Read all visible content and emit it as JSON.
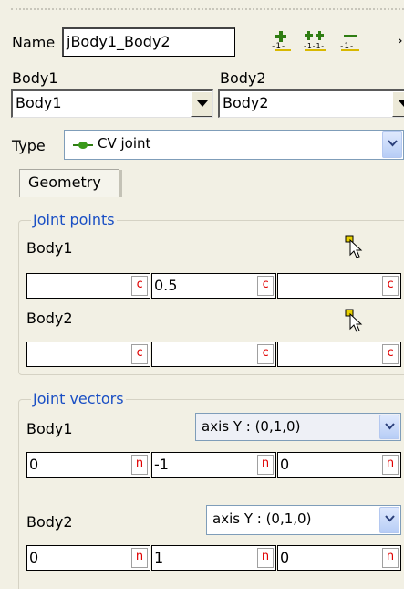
{
  "form": {
    "name_label": "Name",
    "name_value": "jBody1_Body2",
    "body1_label": "Body1",
    "body2_label": "Body2",
    "body1_select": "Body1",
    "body2_select": "Body2",
    "type_label": "Type",
    "type_value": "CV joint"
  },
  "tabs": [
    "Geometry"
  ],
  "joint_points": {
    "title": "Joint points",
    "body1_label": "Body1",
    "body2_label": "Body2",
    "body1_values": [
      "",
      "0.5",
      ""
    ],
    "body2_values": [
      "",
      "",
      ""
    ],
    "tag": "c"
  },
  "joint_vectors": {
    "title": "Joint vectors",
    "body1_label": "Body1",
    "body2_label": "Body2",
    "body1_axis": "axis Y : (0,1,0)",
    "body2_axis": "axis Y : (0,1,0)",
    "body1_values": [
      "0",
      "-1",
      "0"
    ],
    "body2_values": [
      "0",
      "1",
      "0"
    ],
    "tag": "n"
  },
  "colors": {
    "panel_bg": "#f2f0e4",
    "group_title": "#1a4fc4",
    "tag_red": "#e00000",
    "toolbar_yellow": "#d8b800",
    "toolbar_green": "#2f7d12"
  },
  "icons": {
    "toolbar": [
      "add-point-icon",
      "add-two-points-icon",
      "remove-point-icon"
    ],
    "pick": "pick-cursor-icon",
    "joint_type": "cv-joint-icon"
  }
}
